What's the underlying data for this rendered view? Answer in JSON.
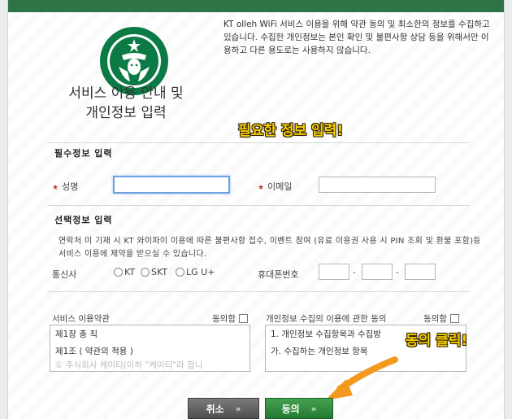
{
  "header": {
    "title": "서비스 이용 안내 및\n개인정보 입력",
    "intro": "KT olleh WiFi 서비스 이용을 위해 약관 동의 및 최소한의 정보를 수집하고 있습니다. 수집한 개인정보는 본인 확인 및 불편사항 상담 등을 위해서만 이용하고 다른 용도로는 사용하지 않습니다."
  },
  "annotations": {
    "top": "필요한 정보 입력!",
    "bottom": "동의 클릭!"
  },
  "required": {
    "section_title": "필수정보 입력",
    "name_label": "성명",
    "email_label": "이메일"
  },
  "optional": {
    "section_title": "선택정보 입력",
    "notice": "연락처 미 기재 시 KT 와이파이 이용에 따른 불편사항 접수, 이벤트 참여 (유료 이용권 사용 시 PIN 조회 및 환불 포함)등 서비스 이용에 제약을 받으실 수 있습니다.",
    "carrier_label": "통신사",
    "carriers": [
      "KT",
      "SKT",
      "LG U+"
    ],
    "phone_label": "휴대폰번호",
    "dash": "-"
  },
  "terms": {
    "service": {
      "label": "서비스 이용약관",
      "agree_label": "동의함",
      "lines": [
        "제1장 총 칙",
        "제1조 ( 약관의 적용 )",
        "① 주식회사 케이티(이하 \"케이티\"라 합니"
      ]
    },
    "privacy": {
      "label": "개인정보 수집의 이용에 관한 동의",
      "agree_label": "동의함",
      "lines": [
        "1. 개인정보 수집항목과 수집방",
        "가. 수집하는 개인정보 항목"
      ]
    }
  },
  "buttons": {
    "cancel": "취소",
    "agree": "동의",
    "chevron": "»"
  },
  "colors": {
    "brand_green": "#2f7447",
    "annotation_yellow": "#f7d200",
    "arrow_orange": "#f39a1e",
    "required_star": "#c0392b"
  }
}
